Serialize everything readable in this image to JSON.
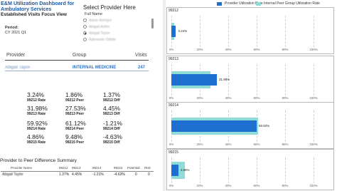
{
  "report": {
    "title": "E&M Utilization Dashboard for Ambulatory Services",
    "subtitle": "Established Visits Focus View",
    "period_label": "Period:",
    "period_value": "CY 2021 Q1"
  },
  "selector": {
    "heading": "Select Provider Here",
    "field_label": "Full Name",
    "options": [
      {
        "label": "Aaron Ashrgrn"
      },
      {
        "label": "Abigail Ashrn"
      },
      {
        "label": "Abigail Taylor"
      },
      {
        "label": "Adenwale Odeife"
      }
    ],
    "selected_index": 2
  },
  "provider_table": {
    "headers": {
      "provider": "Provider",
      "group": "Group",
      "visits": "Visits"
    },
    "row": {
      "provider": "Abigail Taylor",
      "group": "INTERNAL MEDICINE",
      "visits": "247"
    }
  },
  "kpis": [
    [
      {
        "value": "3.24%",
        "label": "99212 Rate"
      },
      {
        "value": "1.86%",
        "label": "99212 Peer"
      },
      {
        "value": "1.37%",
        "label": "99212 Diff"
      }
    ],
    [
      {
        "value": "31.98%",
        "label": "99213 Rate"
      },
      {
        "value": "27.53%",
        "label": "99213 Peer"
      },
      {
        "value": "4.45%",
        "label": "99213 Diff"
      }
    ],
    [
      {
        "value": "59.92%",
        "label": "99214 Rate"
      },
      {
        "value": "61.12%",
        "label": "99214 Peer"
      },
      {
        "value": "-1.21%",
        "label": "99214 Diff"
      }
    ],
    [
      {
        "value": "4.86%",
        "label": "99215 Rate"
      },
      {
        "value": "9.48%",
        "label": "99215 Peer"
      },
      {
        "value": "-4.63%",
        "label": "99215 Diff"
      }
    ]
  ],
  "summary": {
    "title": "Provider to Peer Difference Summary",
    "headers": [
      "Provider Name",
      "99212",
      "99213",
      "99214",
      "99215",
      "Potential",
      "Risk"
    ],
    "row": [
      "Abigail Taylor",
      "1.37%",
      "4.45%",
      "-1.21%",
      "-4.63%",
      "0",
      "0"
    ]
  },
  "colors": {
    "rate": "#1f6fd0",
    "peer": "#8fdcd6",
    "accent": "#1e5aa8"
  },
  "chart_data": [
    {
      "type": "bar",
      "title": "99212",
      "series": [
        {
          "name": "Provider Utilization Rate",
          "values": [
            3.24
          ]
        },
        {
          "name": "Internal Peer Group Utilization Rate",
          "values": [
            1.86
          ]
        }
      ],
      "data_labels": [
        "3.24%"
      ],
      "xlim": [
        0,
        100
      ],
      "ticks": [
        "0%",
        "20%",
        "40%",
        "60%",
        "80%",
        "100%"
      ],
      "legend": "top"
    },
    {
      "type": "bar",
      "title": "99213",
      "series": [
        {
          "name": "Provider Utilization Rate",
          "values": [
            31.98
          ]
        },
        {
          "name": "Internal Peer Group Utilization Rate",
          "values": [
            27.53
          ]
        }
      ],
      "data_labels": [
        "31.98%"
      ],
      "xlim": [
        0,
        100
      ],
      "ticks": [
        "0%",
        "20%",
        "40%",
        "60%",
        "80%",
        "100%"
      ]
    },
    {
      "type": "bar",
      "title": "99214",
      "series": [
        {
          "name": "Provider Utilization Rate",
          "values": [
            59.92
          ]
        },
        {
          "name": "Internal Peer Group Utilization Rate",
          "values": [
            61.12
          ]
        }
      ],
      "data_labels": [
        "59.92%"
      ],
      "xlim": [
        0,
        100
      ],
      "ticks": [
        "0%",
        "20%",
        "40%",
        "60%",
        "80%",
        "100%"
      ]
    },
    {
      "type": "bar",
      "title": "99215",
      "series": [
        {
          "name": "Provider Utilization Rate",
          "values": [
            4.86
          ]
        },
        {
          "name": "Internal Peer Group Utilization Rate",
          "values": [
            9.48
          ]
        }
      ],
      "data_labels": [
        "4.86%"
      ],
      "xlim": [
        0,
        100
      ],
      "ticks": [
        "0%",
        "20%",
        "40%",
        "60%",
        "80%",
        "100%"
      ]
    }
  ]
}
